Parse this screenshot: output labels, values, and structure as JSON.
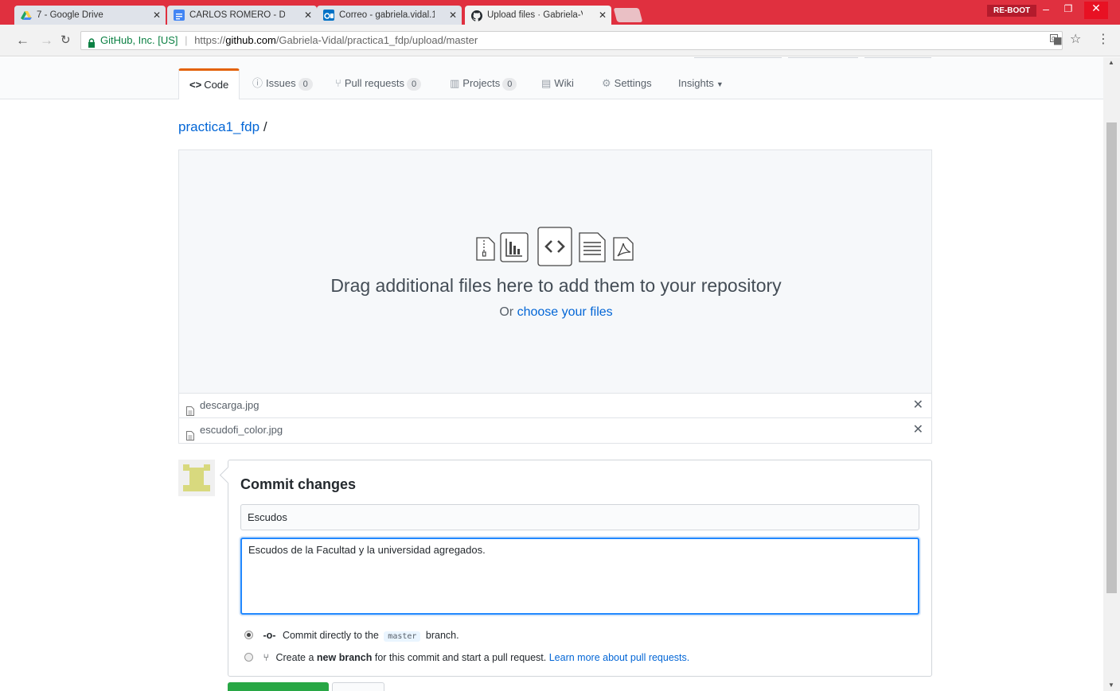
{
  "browser": {
    "tabs": [
      {
        "title": "7 - Google Drive",
        "icon": "google-drive-icon",
        "color": "#f4b400"
      },
      {
        "title": "CARLOS ROMERO - Doc",
        "icon": "google-docs-icon",
        "color": "#4285f4"
      },
      {
        "title": "Correo - gabriela.vidal.1",
        "icon": "outlook-icon",
        "color": "#0072c6"
      },
      {
        "title": "Upload files · Gabriela-Vi",
        "icon": "github-icon",
        "color": "#24292e"
      }
    ],
    "profile_label": "RE-BOOT",
    "security_label": "GitHub, Inc. [US]",
    "url_scheme": "https://",
    "url_host": "github.com",
    "url_path": "/Gabriela-Vidal/practica1_fdp/upload/master",
    "accent_color": "#e0303f"
  },
  "reponav": {
    "code": "Code",
    "issues": "Issues",
    "issues_count": "0",
    "pulls": "Pull requests",
    "pulls_count": "0",
    "projects": "Projects",
    "projects_count": "0",
    "wiki": "Wiki",
    "settings": "Settings",
    "insights": "Insights"
  },
  "breadcrumb": {
    "repo": "practica1_fdp",
    "separator": "/"
  },
  "dropzone": {
    "title": "Drag additional files here to add them to your repository",
    "sub_prefix": "Or",
    "sub_link": "choose your files"
  },
  "files": [
    {
      "name": "descarga.jpg"
    },
    {
      "name": "escudofi_color.jpg"
    }
  ],
  "commit": {
    "title": "Commit changes",
    "summary": "Escudos",
    "description": "Escudos de la Facultad y la universidad agregados.",
    "option_direct_prefix": "Commit directly to the",
    "option_direct_branch": "master",
    "option_direct_suffix": "branch.",
    "option_new_prefix": "Create a",
    "option_new_bold": "new branch",
    "option_new_suffix": "for this commit and start a pull request.",
    "option_new_link": "Learn more about pull requests."
  }
}
